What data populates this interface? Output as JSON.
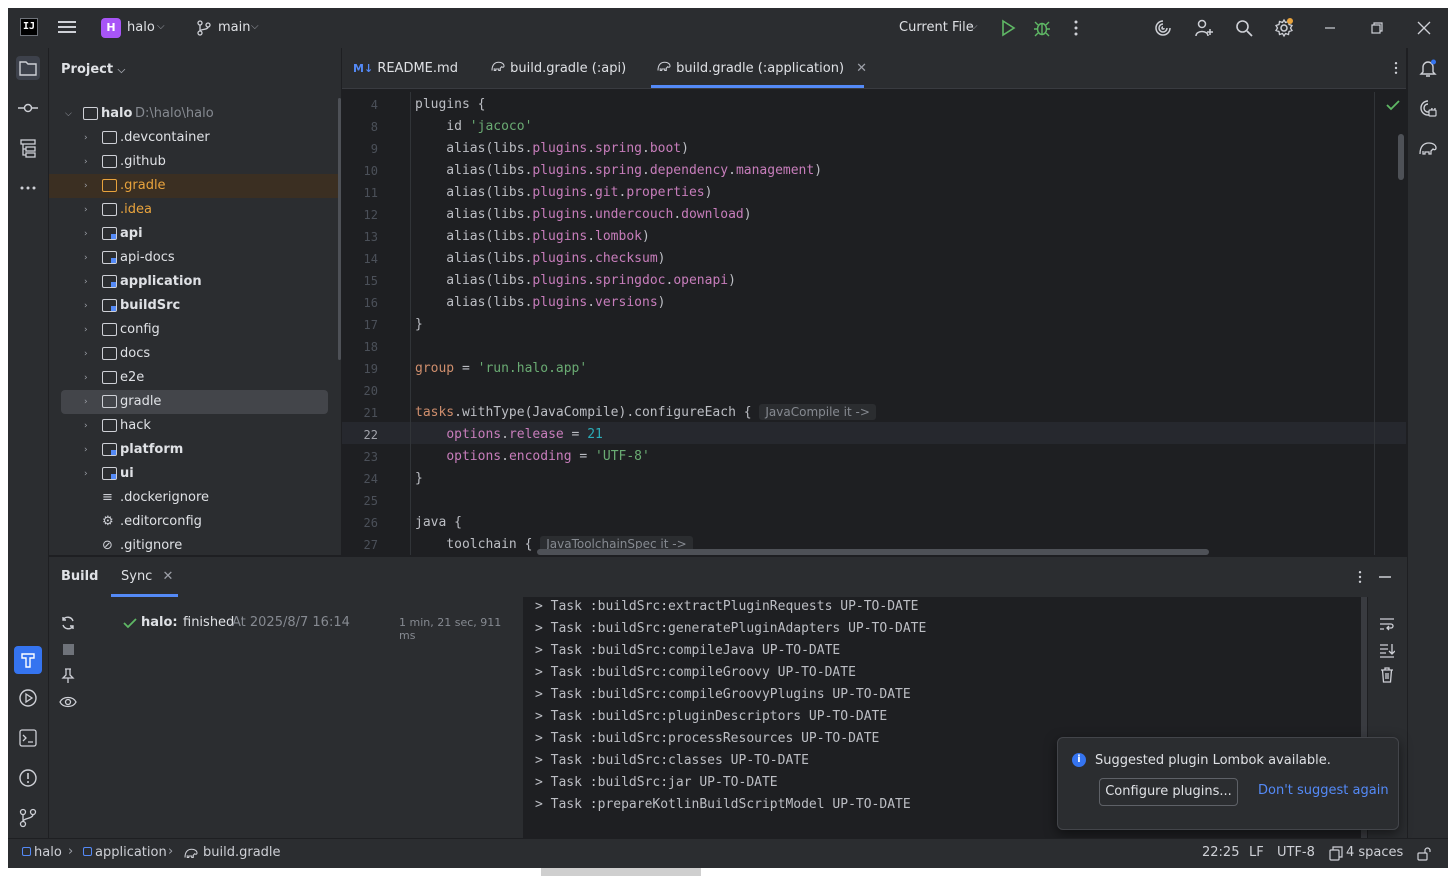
{
  "titlebar": {
    "logo": "IJ",
    "project_badge": "H",
    "project_name": "halo",
    "branch": "main",
    "run_config": "Current File"
  },
  "project_panel": {
    "title": "Project",
    "root": {
      "name": "halo",
      "path": "D:\\halo\\halo"
    },
    "items": [
      {
        "name": ".devcontainer",
        "type": "folder"
      },
      {
        "name": ".github",
        "type": "folder"
      },
      {
        "name": ".gradle",
        "type": "folder"
      },
      {
        "name": ".idea",
        "type": "folder"
      },
      {
        "name": "api",
        "type": "module"
      },
      {
        "name": "api-docs",
        "type": "module"
      },
      {
        "name": "application",
        "type": "module"
      },
      {
        "name": "buildSrc",
        "type": "module"
      },
      {
        "name": "config",
        "type": "folder"
      },
      {
        "name": "docs",
        "type": "folder"
      },
      {
        "name": "e2e",
        "type": "folder"
      },
      {
        "name": "gradle",
        "type": "folder"
      },
      {
        "name": "hack",
        "type": "folder"
      },
      {
        "name": "platform",
        "type": "module"
      },
      {
        "name": "ui",
        "type": "module"
      },
      {
        "name": ".dockerignore",
        "type": "file"
      },
      {
        "name": ".editorconfig",
        "type": "file"
      },
      {
        "name": ".gitignore",
        "type": "file"
      }
    ]
  },
  "tabs": [
    {
      "label": "README.md",
      "prefix": "M↓"
    },
    {
      "label": "build.gradle (:api)"
    },
    {
      "label": "build.gradle (:application)",
      "active": true
    }
  ],
  "code": {
    "line_numbers": [
      "4",
      "8",
      "9",
      "10",
      "11",
      "12",
      "13",
      "14",
      "15",
      "16",
      "17",
      "18",
      "19",
      "20",
      "21",
      "22",
      "23",
      "24",
      "25",
      "26",
      "27"
    ],
    "hint_configure": "JavaCompile it ->",
    "hint_toolchain": "JavaToolchainSpec it ->"
  },
  "build_panel": {
    "tab_build": "Build",
    "tab_sync": "Sync",
    "result_project": "halo:",
    "result_status": "finished",
    "result_time": "At 2025/8/7 16:14",
    "duration": "1 min, 21 sec, 911 ms",
    "console": [
      "> Task :buildSrc:extractPluginRequests UP-TO-DATE",
      "> Task :buildSrc:generatePluginAdapters UP-TO-DATE",
      "> Task :buildSrc:compileJava UP-TO-DATE",
      "> Task :buildSrc:compileGroovy UP-TO-DATE",
      "> Task :buildSrc:compileGroovyPlugins UP-TO-DATE",
      "> Task :buildSrc:pluginDescriptors UP-TO-DATE",
      "> Task :buildSrc:processResources UP-TO-DATE",
      "> Task :buildSrc:classes UP-TO-DATE",
      "> Task :buildSrc:jar UP-TO-DATE",
      "> Task :prepareKotlinBuildScriptModel UP-TO-DATE"
    ]
  },
  "notification": {
    "message": "Suggested plugin Lombok available.",
    "configure_button": "Configure plugins...",
    "dismiss_link": "Don't suggest again"
  },
  "statusbar": {
    "breadcrumb": [
      "halo",
      "application",
      "build.gradle"
    ],
    "position": "22:25",
    "line_ending": "LF",
    "encoding": "UTF-8",
    "indent": "4 spaces"
  }
}
